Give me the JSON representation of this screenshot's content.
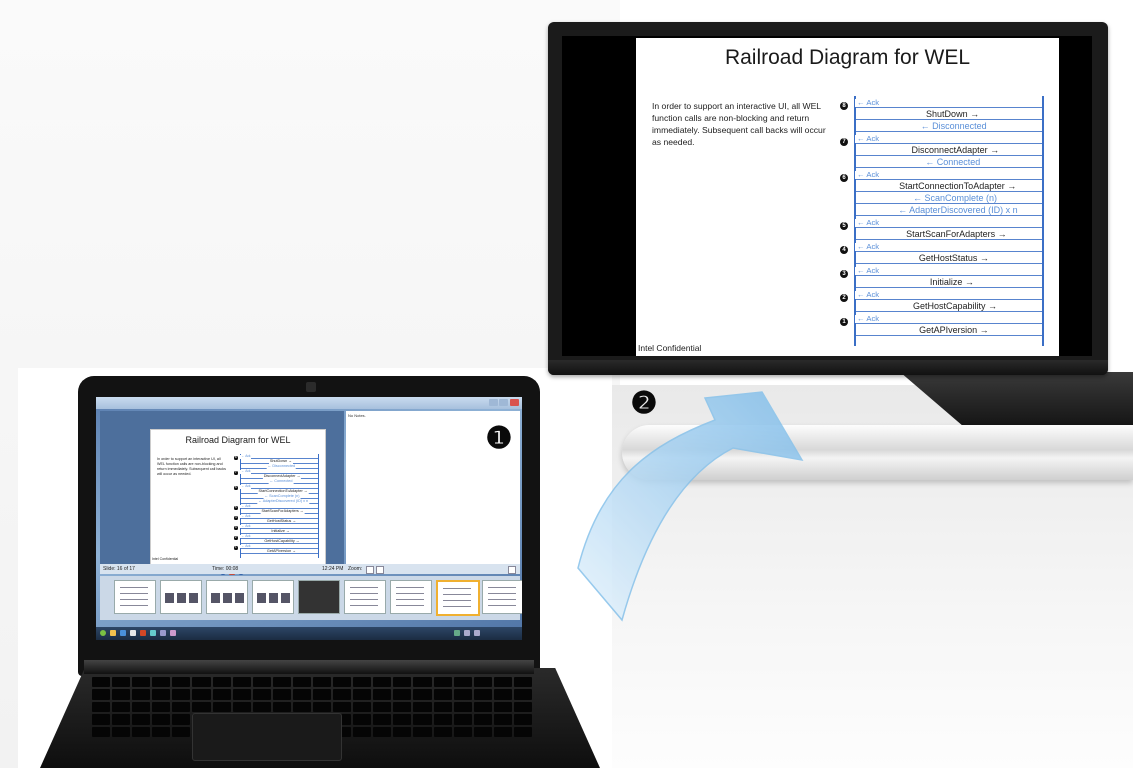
{
  "slide": {
    "title": "Railroad Diagram for WEL",
    "body": "In order to support an interactive UI, all WEL function calls are non-blocking and return immediately.  Subsequent call backs will occur as needed.",
    "footer": "Intel Confidential",
    "diagram": [
      {
        "step": "8",
        "messages": [
          {
            "text": "Ack",
            "dir": "left",
            "color": "blue",
            "kind": "ack"
          },
          {
            "text": "ShutDown",
            "dir": "right",
            "color": "dark",
            "kind": "call"
          }
        ]
      },
      {
        "step": null,
        "messages": [
          {
            "text": "Disconnected",
            "dir": "left",
            "color": "blue",
            "kind": "callback"
          }
        ]
      },
      {
        "step": "7",
        "messages": [
          {
            "text": "Ack",
            "dir": "left",
            "color": "blue",
            "kind": "ack"
          },
          {
            "text": "DisconnectAdapter",
            "dir": "right",
            "color": "dark",
            "kind": "call"
          }
        ]
      },
      {
        "step": null,
        "messages": [
          {
            "text": "Connected",
            "dir": "left",
            "color": "blue",
            "kind": "callback"
          }
        ]
      },
      {
        "step": "6",
        "messages": [
          {
            "text": "Ack",
            "dir": "left",
            "color": "blue",
            "kind": "ack"
          },
          {
            "text": "StartConnectionToAdapter",
            "dir": "right",
            "color": "dark",
            "kind": "call"
          }
        ]
      },
      {
        "step": null,
        "messages": [
          {
            "text": "ScanComplete (n)",
            "dir": "left",
            "color": "blue",
            "kind": "callback"
          },
          {
            "text": "AdapterDiscovered (ID) x n",
            "dir": "left",
            "color": "blue",
            "kind": "callback"
          }
        ]
      },
      {
        "step": "5",
        "messages": [
          {
            "text": "Ack",
            "dir": "left",
            "color": "blue",
            "kind": "ack"
          },
          {
            "text": "StartScanForAdapters",
            "dir": "right",
            "color": "dark",
            "kind": "call"
          }
        ]
      },
      {
        "step": "4",
        "messages": [
          {
            "text": "Ack",
            "dir": "left",
            "color": "blue",
            "kind": "ack"
          },
          {
            "text": "GetHostStatus",
            "dir": "right",
            "color": "dark",
            "kind": "call"
          }
        ]
      },
      {
        "step": "3",
        "messages": [
          {
            "text": "Ack",
            "dir": "left",
            "color": "blue",
            "kind": "ack"
          },
          {
            "text": "Initialize",
            "dir": "right",
            "color": "dark",
            "kind": "call"
          }
        ]
      },
      {
        "step": "2",
        "messages": [
          {
            "text": "Ack",
            "dir": "left",
            "color": "blue",
            "kind": "ack"
          },
          {
            "text": "GetHostCapability",
            "dir": "right",
            "color": "dark",
            "kind": "call"
          }
        ]
      },
      {
        "step": "1",
        "messages": [
          {
            "text": "Ack",
            "dir": "left",
            "color": "blue",
            "kind": "ack"
          },
          {
            "text": "GetAPIversion",
            "dir": "right",
            "color": "dark",
            "kind": "call"
          }
        ]
      }
    ]
  },
  "presenter": {
    "notes_label": "No Notes.",
    "slide_counter": "Slide: 16 of 17",
    "timer": "Time: 00:08",
    "clock": "12:24 PM",
    "zoom_label": "Zoom:",
    "thumbnails": [
      {
        "kind": "text"
      },
      {
        "kind": "images"
      },
      {
        "kind": "images"
      },
      {
        "kind": "images"
      },
      {
        "kind": "dark"
      },
      {
        "kind": "text"
      },
      {
        "kind": "text"
      },
      {
        "kind": "active"
      },
      {
        "kind": "text"
      }
    ]
  },
  "markers": {
    "laptop": "❶",
    "monitor": "❷"
  },
  "colors": {
    "diagram_line": "#3b6fc6",
    "callback_text": "#5a8fd8",
    "arrow_fill": "#9ccbef",
    "arrow_stroke": "#6aaee0",
    "highlight_thumb": "#f0b030"
  }
}
